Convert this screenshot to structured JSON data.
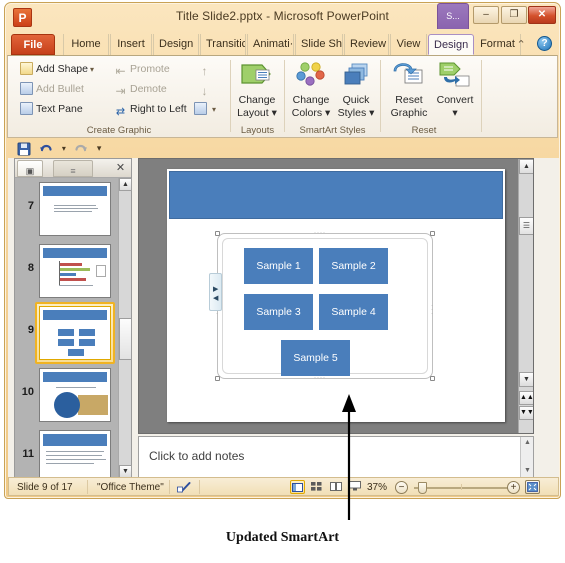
{
  "window": {
    "title": "Title Slide2.pptx  -  Microsoft PowerPoint",
    "logo": "P",
    "contextual_tab_group": "S...",
    "buttons": {
      "minimize": "–",
      "maximize": "❐",
      "close": "✕"
    }
  },
  "tabs": [
    {
      "label": "File",
      "name": "tab-file"
    },
    {
      "label": "Home",
      "name": "tab-home"
    },
    {
      "label": "Insert",
      "name": "tab-insert"
    },
    {
      "label": "Design",
      "name": "tab-design"
    },
    {
      "label": "Transitic",
      "name": "tab-transitions"
    },
    {
      "label": "Animati·",
      "name": "tab-animations"
    },
    {
      "label": "Slide Sh",
      "name": "tab-slideshow"
    },
    {
      "label": "Review",
      "name": "tab-review"
    },
    {
      "label": "View",
      "name": "tab-view"
    },
    {
      "label": "Design",
      "name": "tab-smartart-design",
      "active": true
    },
    {
      "label": "Format",
      "name": "tab-smartart-format"
    }
  ],
  "ribbon": {
    "minimize_glyph": "⌃",
    "help_glyph": "?",
    "create_graphic": {
      "label": "Create Graphic",
      "add_shape": "Add Shape",
      "add_bullet": "Add Bullet",
      "text_pane": "Text Pane",
      "promote": "Promote",
      "demote": "Demote",
      "right_to_left": "Right to Left",
      "move_up": "↑",
      "move_down": "↓",
      "layout_caret": "▾"
    },
    "layouts": {
      "label": "Layouts",
      "change_layout_line1": "Change",
      "change_layout_line2": "Layout ▾"
    },
    "smartart_styles": {
      "label": "SmartArt Styles",
      "change_colors_line1": "Change",
      "change_colors_line2": "Colors ▾",
      "quick_styles_line1": "Quick",
      "quick_styles_line2": "Styles ▾"
    },
    "reset": {
      "label": "Reset",
      "reset_graphic_line1": "Reset",
      "reset_graphic_line2": "Graphic",
      "convert_line1": "Convert",
      "convert_line2": "▾"
    }
  },
  "quick_access": {
    "save": "save-icon",
    "undo": "undo-icon",
    "undo_caret": "▾",
    "redo": "redo-icon",
    "customize_caret": "▾"
  },
  "slide_panel": {
    "tab_slides": "▣",
    "tab_outline": "≡",
    "close": "✕",
    "scroll_up": "▲",
    "scroll_down": "▼",
    "thumbnails": [
      {
        "number": "7",
        "type": "text",
        "selected": false
      },
      {
        "number": "8",
        "type": "chart",
        "selected": false
      },
      {
        "number": "9",
        "type": "smartart",
        "selected": true
      },
      {
        "number": "10",
        "type": "picture",
        "selected": false
      },
      {
        "number": "11",
        "type": "text",
        "selected": false
      }
    ]
  },
  "slide": {
    "smartart": {
      "nodes": [
        {
          "id": "sa1",
          "label": "Sample 1"
        },
        {
          "id": "sa2",
          "label": "Sample 2"
        },
        {
          "id": "sa3",
          "label": "Sample 3"
        },
        {
          "id": "sa4",
          "label": "Sample 4"
        },
        {
          "id": "sa5",
          "label": "Sample 5"
        }
      ],
      "text_pane_chevrons": "▸◂"
    },
    "accent_color": "#4a7ebb",
    "scroll_up": "▲",
    "scroll_down": "▼",
    "prev_slide": "▲▲",
    "next_slide": "▼▼"
  },
  "notes": {
    "placeholder": "Click to add notes",
    "scroll_up": "▲",
    "scroll_down": "▼"
  },
  "status_bar": {
    "slide_counter": "Slide 9 of 17",
    "theme": "\"Office Theme\"",
    "spellcheck": "spellcheck-icon",
    "views": [
      {
        "name": "view-normal",
        "glyph": "▥",
        "active": true
      },
      {
        "name": "view-slide-sorter",
        "glyph": "⌸",
        "active": false
      },
      {
        "name": "view-reading",
        "glyph": "◫",
        "active": false
      },
      {
        "name": "view-slideshow",
        "glyph": "⬒",
        "active": false
      }
    ],
    "zoom_level": "37%",
    "zoom_out": "−",
    "zoom_in": "+",
    "fit_to_window": "fit-to-window-icon"
  },
  "annotation": {
    "caption": "Updated SmartArt"
  }
}
